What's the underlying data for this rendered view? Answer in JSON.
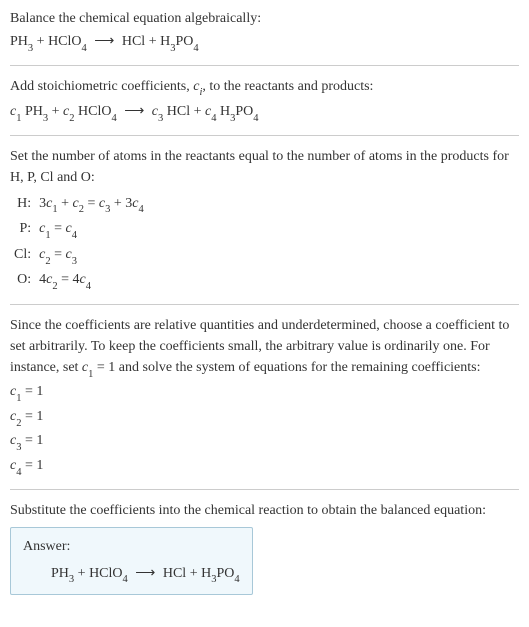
{
  "intro": {
    "line1": "Balance the chemical equation algebraically:",
    "reactant1": "PH",
    "reactant1_sub": "3",
    "reactant2": "HClO",
    "reactant2_sub": "4",
    "arrow": "⟶",
    "product1": "HCl",
    "product2": "H",
    "product2_sub1": "3",
    "product2_mid": "PO",
    "product2_sub2": "4"
  },
  "stoich": {
    "text_before": "Add stoichiometric coefficients, ",
    "ci": "c",
    "ci_sub": "i",
    "text_after": ", to the reactants and products:",
    "c1": "c",
    "c1_sub": "1",
    "r1": "PH",
    "r1_sub": "3",
    "plus": " + ",
    "c2": "c",
    "c2_sub": "2",
    "r2": "HClO",
    "r2_sub": "4",
    "arrow": "⟶",
    "c3": "c",
    "c3_sub": "3",
    "p1": "HCl",
    "c4": "c",
    "c4_sub": "4",
    "p2a": "H",
    "p2a_sub": "3",
    "p2b": "PO",
    "p2b_sub": "4"
  },
  "atoms": {
    "intro": "Set the number of atoms in the reactants equal to the number of atoms in the products for H, P, Cl and O:",
    "rows": [
      {
        "label": "H:",
        "eq_a": "3",
        "eq_b": "c",
        "eq_b_sub": "1",
        "eq_c": " + ",
        "eq_d": "c",
        "eq_d_sub": "2",
        "eq_e": " = ",
        "eq_f": "c",
        "eq_f_sub": "3",
        "eq_g": " + 3",
        "eq_h": "c",
        "eq_h_sub": "4"
      },
      {
        "label": "P:",
        "eq_a": "",
        "eq_b": "c",
        "eq_b_sub": "1",
        "eq_c": "",
        "eq_d": "",
        "eq_d_sub": "",
        "eq_e": " = ",
        "eq_f": "c",
        "eq_f_sub": "4",
        "eq_g": "",
        "eq_h": "",
        "eq_h_sub": ""
      },
      {
        "label": "Cl:",
        "eq_a": "",
        "eq_b": "c",
        "eq_b_sub": "2",
        "eq_c": "",
        "eq_d": "",
        "eq_d_sub": "",
        "eq_e": " = ",
        "eq_f": "c",
        "eq_f_sub": "3",
        "eq_g": "",
        "eq_h": "",
        "eq_h_sub": ""
      },
      {
        "label": "O:",
        "eq_a": "4",
        "eq_b": "c",
        "eq_b_sub": "2",
        "eq_c": "",
        "eq_d": "",
        "eq_d_sub": "",
        "eq_e": " = 4",
        "eq_f": "c",
        "eq_f_sub": "4",
        "eq_g": "",
        "eq_h": "",
        "eq_h_sub": ""
      }
    ]
  },
  "choose": {
    "text_before": "Since the coefficients are relative quantities and underdetermined, choose a coefficient to set arbitrarily. To keep the coefficients small, the arbitrary value is ordinarily one. For instance, set ",
    "c1": "c",
    "c1_sub": "1",
    "text_after": " = 1 and solve the system of equations for the remaining coefficients:",
    "results": [
      {
        "c": "c",
        "sub": "1",
        "val": " = 1"
      },
      {
        "c": "c",
        "sub": "2",
        "val": " = 1"
      },
      {
        "c": "c",
        "sub": "3",
        "val": " = 1"
      },
      {
        "c": "c",
        "sub": "4",
        "val": " = 1"
      }
    ]
  },
  "substitute": {
    "text": "Substitute the coefficients into the chemical reaction to obtain the balanced equation:"
  },
  "answer": {
    "label": "Answer:",
    "r1": "PH",
    "r1_sub": "3",
    "plus": " + ",
    "r2": "HClO",
    "r2_sub": "4",
    "arrow": "⟶",
    "p1": "HCl",
    "p2a": "H",
    "p2a_sub": "3",
    "p2b": "PO",
    "p2b_sub": "4"
  }
}
